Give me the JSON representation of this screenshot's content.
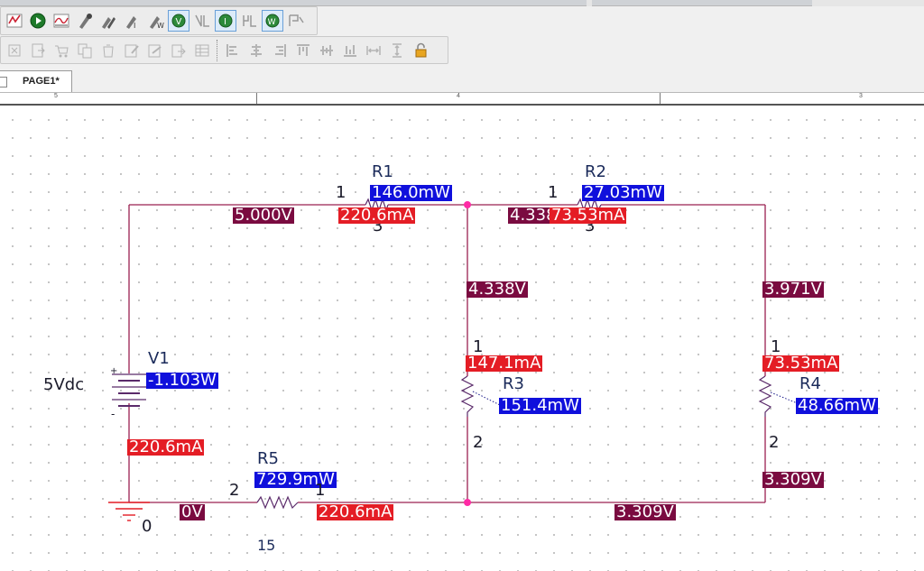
{
  "tabs": [
    {
      "label": "PAGE1*"
    }
  ],
  "ruler": {
    "marks": [
      "5",
      "4",
      "3"
    ]
  },
  "toolbar": {
    "row1": [
      "simulation-settings-icon",
      "run-icon",
      "view-results-icon",
      "voltage-marker-icon",
      "differential-marker-icon",
      "current-marker-icon",
      "power-marker-icon",
      "show-voltages-icon",
      "enable-voltage-icon",
      "show-currents-icon",
      "enable-current-icon",
      "show-power-icon",
      "enable-power-icon"
    ],
    "row2": [
      "cut-icon",
      "paste-icon",
      "cart-icon",
      "copy-icon",
      "trash-icon",
      "edit-icon",
      "edit2-icon",
      "export-icon",
      "table-icon",
      "align-left-icon",
      "align-center-icon",
      "align-right-icon",
      "align-top-icon",
      "align-middle-icon",
      "align-bottom-icon",
      "distribute-h-icon",
      "distribute-v-icon",
      "lock-icon"
    ]
  },
  "schematic": {
    "source": {
      "ref": "V1",
      "value": "5Vdc",
      "power": "-1.103W",
      "current": "220.6mA",
      "plus": "+",
      "minus": "-"
    },
    "ground": {
      "label": "0",
      "node_voltage": "0V"
    },
    "r1": {
      "ref": "R1",
      "pin1": "1",
      "pin2": "3",
      "power": "146.0mW",
      "current": "220.6mA"
    },
    "r2": {
      "ref": "R2",
      "pin1": "1",
      "pin2": "3",
      "power": "27.03mW",
      "current": "73.53mA"
    },
    "r3": {
      "ref": "R3",
      "pin1": "1",
      "pin2": "2",
      "power": "151.4mW",
      "current": "147.1mA"
    },
    "r4": {
      "ref": "R4",
      "pin1": "1",
      "pin2": "2",
      "power": "48.66mW",
      "current": "73.53mA"
    },
    "r5": {
      "ref": "R5",
      "pin1": "1",
      "pin2": "2",
      "power": "729.9mW",
      "current": "220.6mA",
      "value": "15"
    },
    "voltages": {
      "n_top_left": "5.000V",
      "n_mid_label": "4.338V",
      "n_mid_overlap": "4.338",
      "n_right": "3.971V",
      "n_bottom_right": "3.309V",
      "n_bottom_mid": "3.309V"
    }
  },
  "colors": {
    "wire": "#9a2050",
    "voltage_bg": "#7a0b40",
    "current_bg": "#e41d25",
    "power_bg": "#1010dc",
    "junction": "#ff2aa5"
  }
}
